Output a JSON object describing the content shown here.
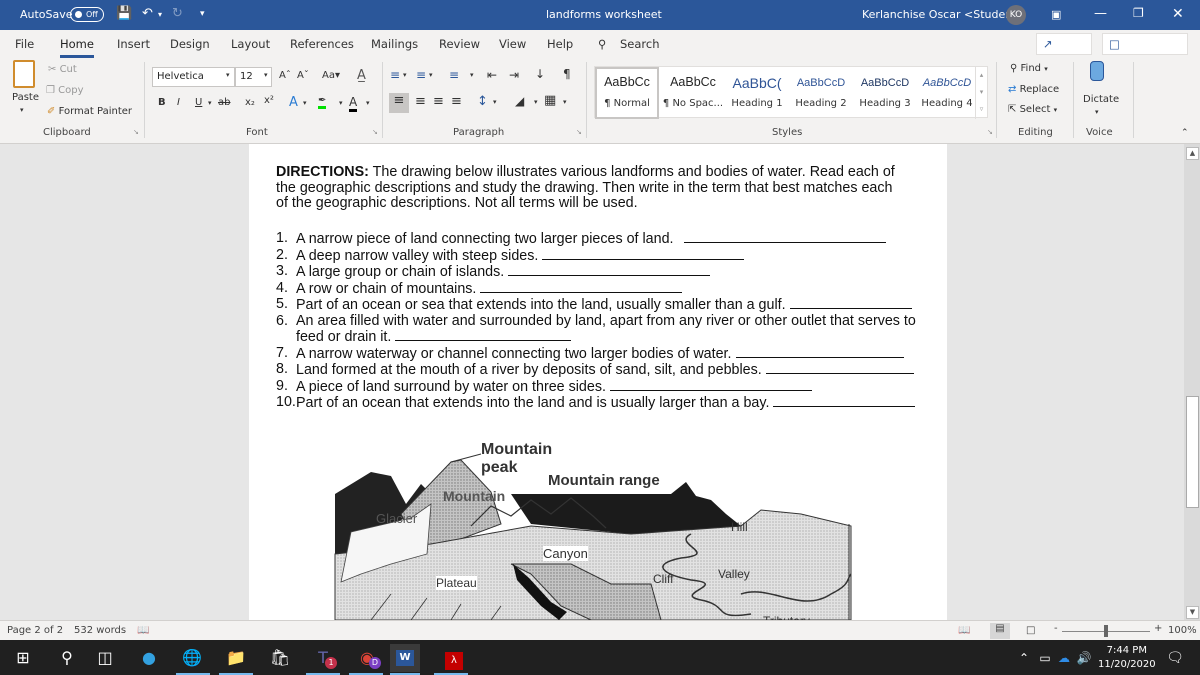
{
  "titlebar": {
    "autosave_label": "AutoSave",
    "autosave_state": "Off",
    "doc_title": "landforms worksheet",
    "user_name": "Kerlanchise Oscar <Student>",
    "user_initials": "KO"
  },
  "menu": {
    "tabs": [
      {
        "label": "File"
      },
      {
        "label": "Home",
        "active": true
      },
      {
        "label": "Insert"
      },
      {
        "label": "Design"
      },
      {
        "label": "Layout"
      },
      {
        "label": "References"
      },
      {
        "label": "Mailings"
      },
      {
        "label": "Review"
      },
      {
        "label": "View"
      },
      {
        "label": "Help"
      }
    ],
    "search_label": "Search",
    "share_label": "Share",
    "comments_label": "Comments"
  },
  "ribbon": {
    "clipboard": {
      "label": "Clipboard",
      "paste": "Paste",
      "cut": "Cut",
      "copy": "Copy",
      "format_painter": "Format Painter"
    },
    "font": {
      "label": "Font",
      "font_name": "Helvetica",
      "font_size": "12",
      "change_case": "Aa"
    },
    "paragraph": {
      "label": "Paragraph"
    },
    "styles": {
      "label": "Styles",
      "items": [
        {
          "preview": "AaBbCc",
          "name": "¶ Normal",
          "color": "#000000"
        },
        {
          "preview": "AaBbCc",
          "name": "¶ No Spac...",
          "color": "#000000"
        },
        {
          "preview": "AaBbC(",
          "name": "Heading 1",
          "color": "#2f5496"
        },
        {
          "preview": "AaBbCcD",
          "name": "Heading 2",
          "color": "#2f5496"
        },
        {
          "preview": "AaBbCcD",
          "name": "Heading 3",
          "color": "#1f3763"
        },
        {
          "preview": "AaBbCcD",
          "name": "Heading 4",
          "color": "#2f5496"
        }
      ]
    },
    "editing": {
      "label": "Editing",
      "find": "Find",
      "replace": "Replace",
      "select": "Select"
    },
    "voice": {
      "label": "Voice",
      "dictate": "Dictate"
    }
  },
  "document": {
    "directions_bold": "DIRECTIONS:",
    "directions_text": " The drawing below illustrates various landforms and bodies of water. Read each of the geographic descriptions and study the drawing. Then write in the term that best matches each of the geographic descriptions. Not all terms will be used.",
    "questions": [
      {
        "num": "1.",
        "text": "A narrow piece of land connecting two larger pieces of land."
      },
      {
        "num": "2.",
        "text": "A deep narrow valley with steep sides."
      },
      {
        "num": "3.",
        "text": "A large group or chain of islands."
      },
      {
        "num": "4.",
        "text": "A row or chain of mountains."
      },
      {
        "num": "5.",
        "text": "Part of an ocean or sea that extends into the land, usually smaller than a gulf."
      },
      {
        "num": "6.",
        "text": "An area filled with water and surrounded by land, apart from any river or other outlet that serves to",
        "cont": "feed or drain it."
      },
      {
        "num": "7.",
        "text": "A narrow waterway or channel connecting two larger bodies of water."
      },
      {
        "num": "8.",
        "text": "Land formed at the mouth of a river by deposits of sand, silt, and pebbles."
      },
      {
        "num": "9.",
        "text": "A piece of land surround by water on three sides."
      },
      {
        "num": "10.",
        "text": "Part of an ocean that extends into the land and is usually larger than a bay."
      }
    ],
    "diagram_labels": {
      "mountain_peak_1": "Mountain",
      "mountain_peak_2": "peak",
      "mountain_range": "Mountain range",
      "mountain": "Mountain",
      "glacier": "Glacier",
      "hill": "Hill",
      "canyon": "Canyon",
      "plateau": "Plateau",
      "cliff": "Cliff",
      "valley": "Valley",
      "tributary": "Tributary"
    }
  },
  "status": {
    "page": "Page 2 of 2",
    "words": "532 words",
    "zoom": "100%"
  },
  "taskbar": {
    "teams_badge": "1",
    "chrome_badge": "D",
    "time": "7:44 PM",
    "date": "11/20/2020"
  }
}
